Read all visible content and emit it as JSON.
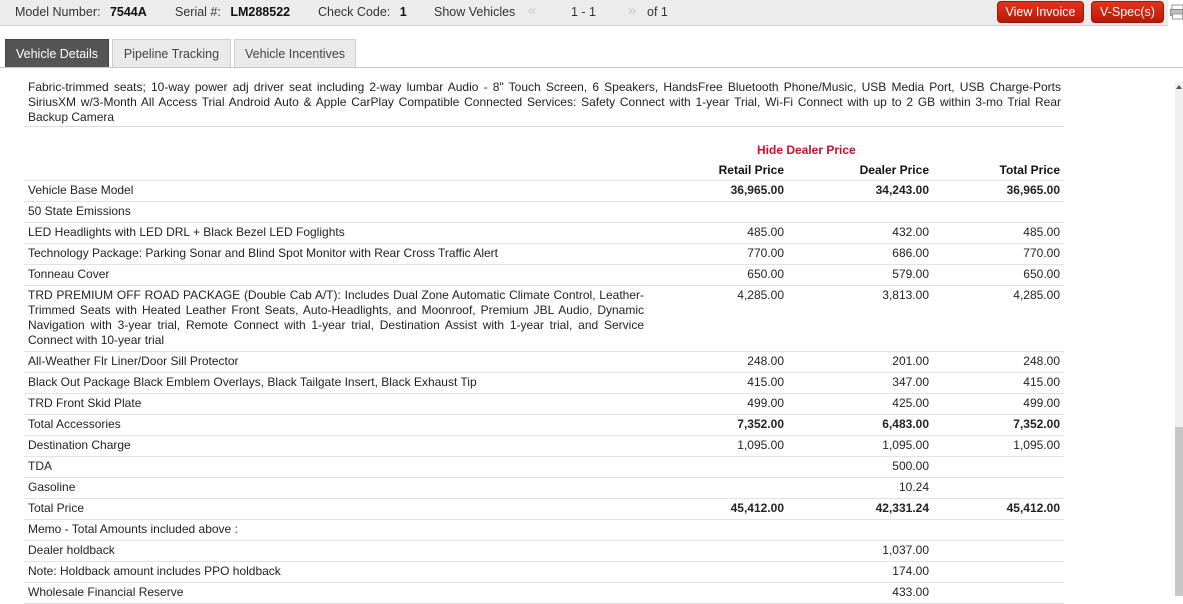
{
  "topbar": {
    "model_label": "Model Number:",
    "model_value": "7544A",
    "serial_label": "Serial #:",
    "serial_value": "LM288522",
    "check_label": "Check Code:",
    "check_value": "1",
    "show_vehicles": "Show Vehicles",
    "prev_arrow": "«",
    "range": "1 - 1",
    "next_arrow": "»",
    "of_total": "of 1",
    "view_invoice": "View Invoice",
    "vspec": "V-Spec(s)"
  },
  "tabs": [
    {
      "label": "Vehicle Details",
      "active": true
    },
    {
      "label": "Pipeline Tracking",
      "active": false
    },
    {
      "label": "Vehicle Incentives",
      "active": false
    }
  ],
  "description": "Fabric-trimmed seats; 10-way power adj driver seat including 2-way lumbar Audio - 8\" Touch Screen, 6 Speakers, HandsFree Bluetooth Phone/Music, USB Media Port, USB Charge-Ports SiriusXM w/3-Month All Access Trial Android Auto & Apple CarPlay Compatible Connected Services: Safety Connect with 1-year Trial, Wi-Fi Connect with up to 2 GB within 3-mo Trial Rear Backup Camera",
  "pricing": {
    "toggle_label": "Hide Dealer Price",
    "headers": {
      "retail": "Retail Price",
      "dealer": "Dealer Price",
      "total": "Total Price"
    },
    "rows": [
      {
        "desc": "Vehicle Base Model",
        "retail": "36,965.00",
        "dealer": "34,243.00",
        "total": "36,965.00",
        "bold": true
      },
      {
        "desc": "50 State Emissions",
        "retail": "",
        "dealer": "",
        "total": ""
      },
      {
        "desc": "LED Headlights with LED DRL + Black Bezel LED Foglights",
        "retail": "485.00",
        "dealer": "432.00",
        "total": "485.00"
      },
      {
        "desc": "Technology Package: Parking Sonar and Blind Spot Monitor with Rear Cross Traffic Alert",
        "retail": "770.00",
        "dealer": "686.00",
        "total": "770.00"
      },
      {
        "desc": "Tonneau Cover",
        "retail": "650.00",
        "dealer": "579.00",
        "total": "650.00"
      },
      {
        "desc": "TRD PREMIUM OFF ROAD PACKAGE (Double Cab A/T): Includes Dual Zone Automatic Climate Control, Leather-Trimmed Seats with Heated Leather Front Seats, Auto-Headlights, and Moonroof, Premium JBL Audio, Dynamic Navigation with 3-year trial, Remote Connect with 1-year trial, Destination Assist with 1-year trial, and Service Connect with 10-year trial",
        "retail": "4,285.00",
        "dealer": "3,813.00",
        "total": "4,285.00"
      },
      {
        "desc": "All-Weather Flr Liner/Door Sill Protector",
        "retail": "248.00",
        "dealer": "201.00",
        "total": "248.00"
      },
      {
        "desc": "Black Out Package Black Emblem Overlays, Black Tailgate Insert, Black Exhaust Tip",
        "retail": "415.00",
        "dealer": "347.00",
        "total": "415.00"
      },
      {
        "desc": "TRD Front Skid Plate",
        "retail": "499.00",
        "dealer": "425.00",
        "total": "499.00"
      },
      {
        "desc": "Total Accessories",
        "retail": "7,352.00",
        "dealer": "6,483.00",
        "total": "7,352.00",
        "bold": true
      },
      {
        "desc": "Destination Charge",
        "retail": "1,095.00",
        "dealer": "1,095.00",
        "total": "1,095.00"
      },
      {
        "desc": "TDA",
        "retail": "",
        "dealer": "500.00",
        "total": ""
      },
      {
        "desc": "Gasoline",
        "retail": "",
        "dealer": "10.24",
        "total": ""
      },
      {
        "desc": "Total Price",
        "retail": "45,412.00",
        "dealer": "42,331.24",
        "total": "45,412.00",
        "bold": true
      },
      {
        "desc": "Memo - Total Amounts included above :",
        "retail": "",
        "dealer": "",
        "total": ""
      },
      {
        "desc": "Dealer holdback",
        "retail": "",
        "dealer": "1,037.00",
        "total": ""
      },
      {
        "desc": "Note: Holdback amount includes PPO holdback",
        "retail": "",
        "dealer": "174.00",
        "total": ""
      },
      {
        "desc": "Wholesale Financial Reserve",
        "retail": "",
        "dealer": "433.00",
        "total": ""
      }
    ]
  },
  "colors": {
    "accent_red": "#c8102e",
    "button_red": "#d2260f",
    "active_tab": "#555555"
  }
}
